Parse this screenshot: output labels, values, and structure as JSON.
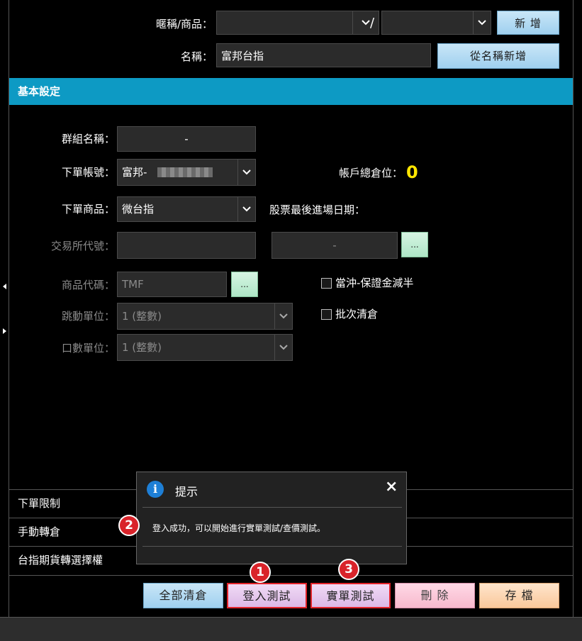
{
  "top": {
    "nickname_label": "暱稱/商品：",
    "slash": "/",
    "add_button": "新 增",
    "name_label": "名稱：",
    "name_value": "富邦台指",
    "add_from_name_button": "從名稱新增"
  },
  "basic_settings": {
    "header": "基本設定",
    "group_name_label": "群組名稱：",
    "group_name_value": "-",
    "account_label": "下單帳號：",
    "account_value": "富邦-",
    "position_label": "帳戶總倉位：",
    "position_value": "0",
    "product_label": "下單商品：",
    "product_value": "微台指",
    "last_entry_label": "股票最後進場日期：",
    "exchange_label": "交易所代號：",
    "exchange_value": "",
    "exchange_second_value": "-",
    "browse_label": "...",
    "code_label": "商品代碼：",
    "code_value": "TMF",
    "tick_label": "跳動單位：",
    "tick_value": "1 (整數)",
    "lot_label": "口數單位：",
    "lot_value": "1 (整數)",
    "daytrade_label": "當沖-保證金減半",
    "batch_close_label": "批次清倉"
  },
  "accordion": {
    "order_limit": "下單限制",
    "manual_transfer": "手動轉倉",
    "futures_to_options": "台指期貨轉選擇權"
  },
  "dialog": {
    "title": "提示",
    "close": "×",
    "message": "登入成功，可以開始進行實單測試/查價測試。",
    "icon": "i"
  },
  "badges": [
    "1",
    "2",
    "3"
  ],
  "bottom_buttons": {
    "clear_all": "全部清倉",
    "login_test": "登入測試",
    "real_test": "實單測試",
    "delete": "刪 除",
    "save": "存 檔"
  },
  "colors": {
    "section_header": "#0d9ac4",
    "position_value": "#ffe600",
    "badge": "#d9232a",
    "highlight": "#e2232a"
  }
}
